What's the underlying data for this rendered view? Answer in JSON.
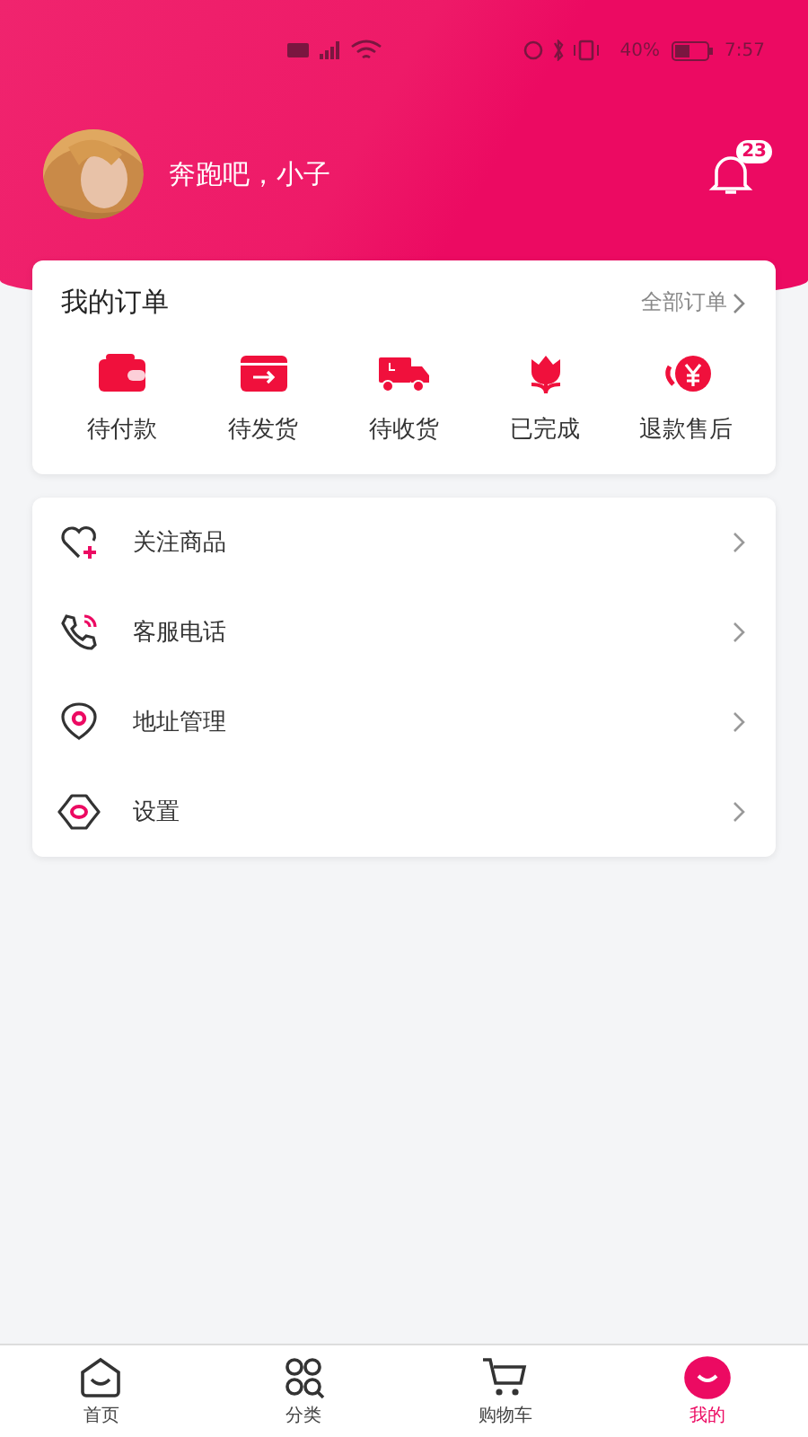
{
  "status_bar": {
    "battery_text": "40%",
    "time": "7:57"
  },
  "profile": {
    "username": "奔跑吧，小子",
    "notifications": "23"
  },
  "orders": {
    "title": "我的订单",
    "all_link": "全部订单",
    "items": [
      {
        "kind": "wallet",
        "label": "待付款"
      },
      {
        "kind": "box",
        "label": "待发货"
      },
      {
        "kind": "truck",
        "label": "待收货"
      },
      {
        "kind": "flower",
        "label": "已完成"
      },
      {
        "kind": "refund",
        "label": "退款售后"
      }
    ]
  },
  "menu": [
    {
      "kind": "favorite",
      "label": "关注商品"
    },
    {
      "kind": "phone",
      "label": "客服电话"
    },
    {
      "kind": "location",
      "label": "地址管理"
    },
    {
      "kind": "settings",
      "label": "设置"
    }
  ],
  "tab_bar": [
    {
      "kind": "home",
      "label": "首页",
      "selected": false
    },
    {
      "kind": "category",
      "label": "分类",
      "selected": false
    },
    {
      "kind": "cart",
      "label": "购物车",
      "selected": false
    },
    {
      "kind": "me",
      "label": "我的",
      "selected": true
    }
  ]
}
